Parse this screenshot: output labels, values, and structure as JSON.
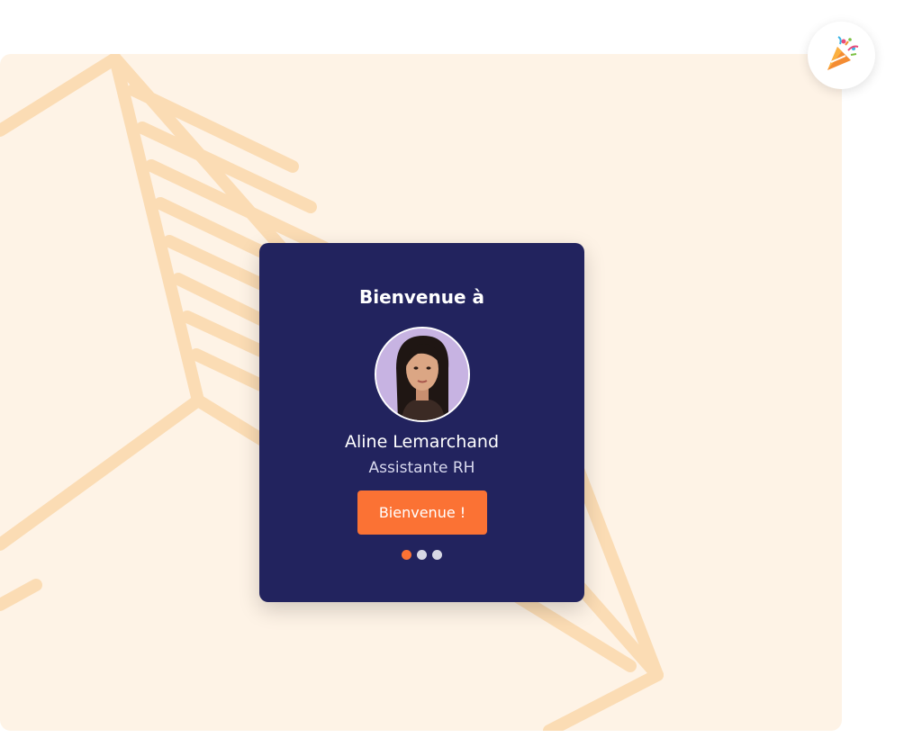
{
  "card": {
    "title": "Bienvenue à",
    "person": {
      "name": "Aline Lemarchand",
      "role": "Assistante RH"
    },
    "button_label": "Bienvenue !"
  },
  "carousel": {
    "total": 3,
    "active_index": 0
  },
  "icons": {
    "celebrate": "party-popper-icon",
    "avatar": "person-photo"
  },
  "colors": {
    "card_background": "#22235e",
    "accent": "#fb7234",
    "panel_background": "#fef3e6",
    "background_lines": "#fbdcb4"
  }
}
